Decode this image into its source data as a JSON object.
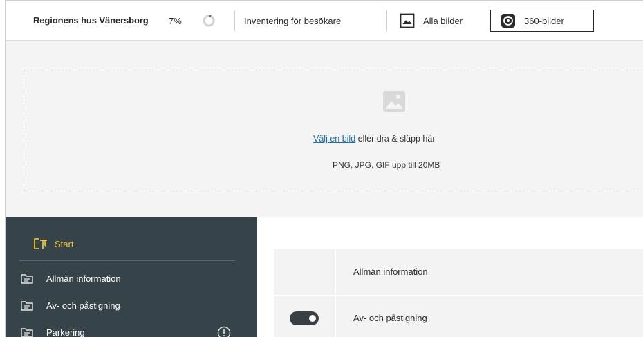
{
  "toolbar": {
    "title": "Regionens hus Vänersborg",
    "progress_label": "7%",
    "progress_value": 0.07,
    "inventory_link": "Inventering för besökare",
    "all_images_label": "Alla bilder",
    "pano_images_label": "360-bilder"
  },
  "upload": {
    "choose_link": "Välj en bild",
    "drop_text": " eller dra & släpp här",
    "formats_text": "PNG, JPG, GIF upp till 20MB"
  },
  "sidebar": {
    "start_label": "Start",
    "items": [
      {
        "label": "Allmän information",
        "icon": "folder-icon"
      },
      {
        "label": "Av- och påstigning",
        "icon": "folder-icon"
      },
      {
        "label": "Parkering",
        "icon": "folder-icon"
      }
    ]
  },
  "table": {
    "rows": [
      {
        "label": "Allmän information",
        "toggle": null
      },
      {
        "label": "Av- och påstigning",
        "toggle": true
      }
    ]
  },
  "colors": {
    "sidebar_bg": "#364449",
    "start_accent": "#e8c23a",
    "link": "#1b6fa8"
  }
}
